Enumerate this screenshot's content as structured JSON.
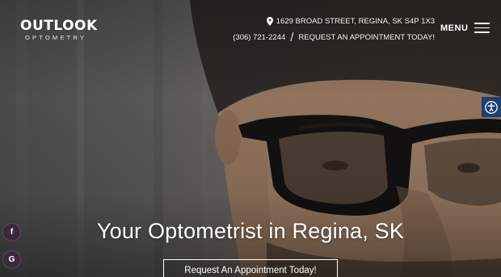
{
  "brand": {
    "name": "OUTLOOK",
    "tagline": "OPTOMETRY"
  },
  "header": {
    "address": "1629 BROAD STREET, REGINA, SK S4P 1X3",
    "phone": "(306) 721-2244",
    "separator": "/",
    "appointment_link": "REQUEST AN APPOINTMENT TODAY!",
    "menu_label": "MENU"
  },
  "hero": {
    "title": "Your Optometrist in Regina, SK",
    "cta_label": "Request An Appointment Today!"
  },
  "social": {
    "facebook_glyph": "f",
    "google_glyph": "G"
  },
  "icons": {
    "address": "map-pin-icon",
    "menu": "hamburger-icon",
    "accessibility": "accessibility-icon",
    "facebook": "facebook-icon",
    "google": "google-icon"
  },
  "colors": {
    "accessibility_button": "#1e3f6f",
    "social_button": "#3a2a3a"
  }
}
